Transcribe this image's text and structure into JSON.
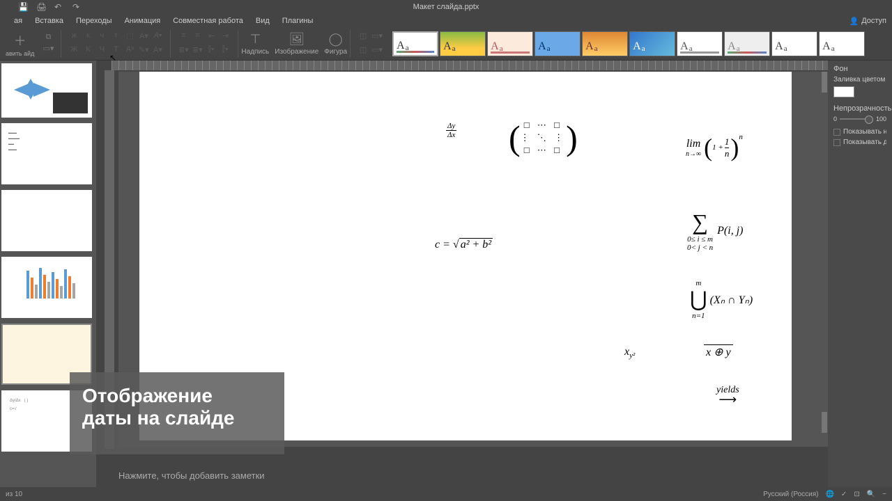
{
  "title": "Макет слайда.pptx",
  "menu": {
    "home": "ая",
    "insert": "Вставка",
    "transitions": "Переходы",
    "animation": "Анимация",
    "collab": "Совместная работа",
    "view": "Вид",
    "plugins": "Плагины"
  },
  "access": "Доступ",
  "toolbar": {
    "addslide": "авить\nайд",
    "textbox": "Надпись",
    "image": "Изображение",
    "shape": "Фигура"
  },
  "right": {
    "bg": "Фон",
    "fill": "Заливка цветом",
    "opacity": "Непрозрачность",
    "min": "0",
    "max": "100",
    "shownum": "Показывать номер",
    "showdate": "Показывать дату и"
  },
  "overlay": {
    "l1": "Отображение",
    "l2": "даты на слайде"
  },
  "notes": "Нажмите, чтобы добавить заметки",
  "status": {
    "slide": "из 10",
    "lang": "Русский (Россия)"
  },
  "slide": {
    "eq1": "Δy",
    "eq1b": "Δx",
    "eq2a": "□  ⋯  □",
    "eq2b": "⋮  ⋱  ⋮",
    "eq2c": "□  ⋯  □",
    "eq3a": "lim",
    "eq3b": "n→∞",
    "eq3c": "1 +",
    "eq3d": "1",
    "eq3e": "n",
    "eq3f": "n",
    "eq4a": "c =",
    "eq4b": "a² + b²",
    "eq5a": "∑",
    "eq5b": "0≤ i ≤ m",
    "eq5c": "0< j < n",
    "eq5d": "P(i, j)",
    "eq6a": "⋃",
    "eq6b": "m",
    "eq6c": "n=1",
    "eq6d": "(Xₙ ∩ Yₙ)",
    "eq7": "x",
    "eq7b": "y²",
    "eq8": "x ⊕ y",
    "eq9": "yields",
    "eq9b": "⟶"
  }
}
